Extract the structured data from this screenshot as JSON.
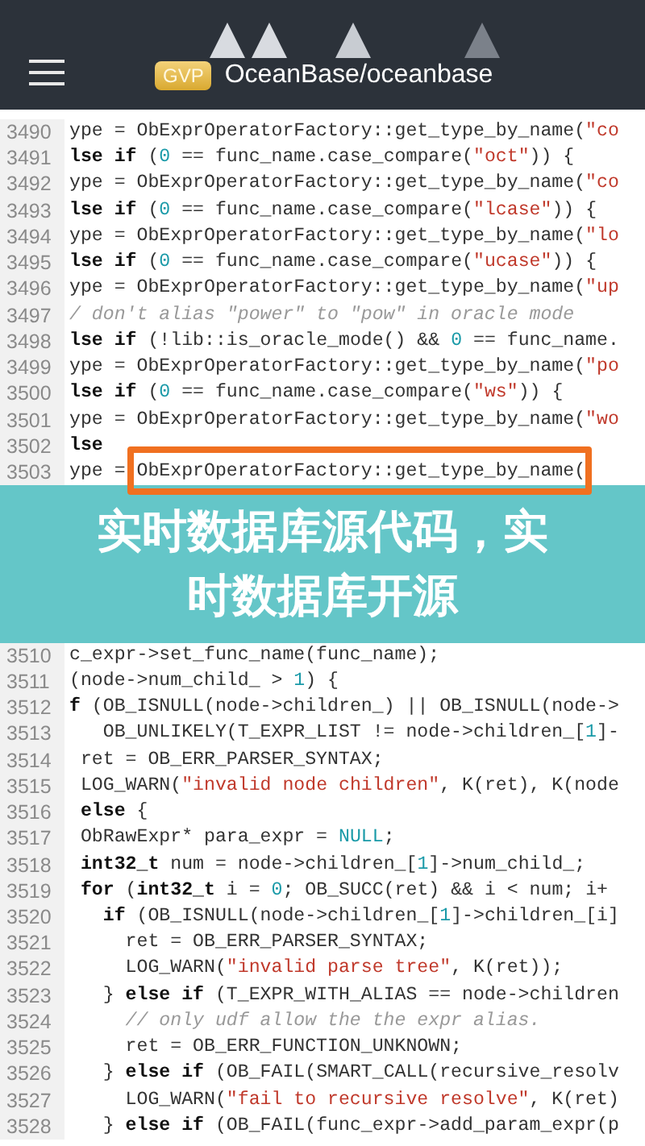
{
  "header": {
    "badge": "GVP",
    "repo": "OceanBase/oceanbase"
  },
  "code_top": [
    {
      "number": "3490",
      "tokens": [
        {
          "kind": "plain",
          "text": "ype = ObExprOperatorFactory::get_type_by_name("
        },
        {
          "kind": "string",
          "text": "\"co"
        }
      ]
    },
    {
      "number": "3491",
      "tokens": [
        {
          "kind": "keyword",
          "text": "lse if"
        },
        {
          "kind": "plain",
          "text": " ("
        },
        {
          "kind": "number",
          "text": "0"
        },
        {
          "kind": "plain",
          "text": " == func_name.case_compare("
        },
        {
          "kind": "string",
          "text": "\"oct\""
        },
        {
          "kind": "plain",
          "text": ")) {"
        }
      ]
    },
    {
      "number": "3492",
      "tokens": [
        {
          "kind": "plain",
          "text": "ype = ObExprOperatorFactory::get_type_by_name("
        },
        {
          "kind": "string",
          "text": "\"co"
        }
      ]
    },
    {
      "number": "3493",
      "tokens": [
        {
          "kind": "keyword",
          "text": "lse if"
        },
        {
          "kind": "plain",
          "text": " ("
        },
        {
          "kind": "number",
          "text": "0"
        },
        {
          "kind": "plain",
          "text": " == func_name.case_compare("
        },
        {
          "kind": "string",
          "text": "\"lcase\""
        },
        {
          "kind": "plain",
          "text": ")) {"
        }
      ]
    },
    {
      "number": "3494",
      "tokens": [
        {
          "kind": "plain",
          "text": "ype = ObExprOperatorFactory::get_type_by_name("
        },
        {
          "kind": "string",
          "text": "\"lo"
        }
      ]
    },
    {
      "number": "3495",
      "tokens": [
        {
          "kind": "keyword",
          "text": "lse if"
        },
        {
          "kind": "plain",
          "text": " ("
        },
        {
          "kind": "number",
          "text": "0"
        },
        {
          "kind": "plain",
          "text": " == func_name.case_compare("
        },
        {
          "kind": "string",
          "text": "\"ucase\""
        },
        {
          "kind": "plain",
          "text": ")) {"
        }
      ]
    },
    {
      "number": "3496",
      "tokens": [
        {
          "kind": "plain",
          "text": "ype = ObExprOperatorFactory::get_type_by_name("
        },
        {
          "kind": "string",
          "text": "\"up"
        }
      ]
    },
    {
      "number": "3497",
      "tokens": [
        {
          "kind": "comment",
          "text": "/ don't alias \"power\" to \"pow\" in oracle mode"
        }
      ]
    },
    {
      "number": "3498",
      "tokens": [
        {
          "kind": "keyword",
          "text": "lse if"
        },
        {
          "kind": "plain",
          "text": " (!lib::is_oracle_mode() && "
        },
        {
          "kind": "number",
          "text": "0"
        },
        {
          "kind": "plain",
          "text": " == func_name."
        }
      ]
    },
    {
      "number": "3499",
      "tokens": [
        {
          "kind": "plain",
          "text": "ype = ObExprOperatorFactory::get_type_by_name("
        },
        {
          "kind": "string",
          "text": "\"po"
        }
      ]
    },
    {
      "number": "3500",
      "tokens": [
        {
          "kind": "keyword",
          "text": "lse if"
        },
        {
          "kind": "plain",
          "text": " ("
        },
        {
          "kind": "number",
          "text": "0"
        },
        {
          "kind": "plain",
          "text": " == func_name.case_compare("
        },
        {
          "kind": "string",
          "text": "\"ws\""
        },
        {
          "kind": "plain",
          "text": ")) {"
        }
      ]
    },
    {
      "number": "3501",
      "tokens": [
        {
          "kind": "plain",
          "text": "ype = ObExprOperatorFactory::get_type_by_name("
        },
        {
          "kind": "string",
          "text": "\"wo"
        }
      ]
    },
    {
      "number": "3502",
      "tokens": [
        {
          "kind": "keyword",
          "text": "lse"
        }
      ]
    },
    {
      "number": "3503",
      "highlight": true,
      "tokens": [
        {
          "kind": "plain",
          "text": "ype = ObExprOperatorFactory::get_type_by_name("
        }
      ]
    }
  ],
  "banner": {
    "title": "实时数据库源代码，实时数据库开源"
  },
  "code_bottom": [
    {
      "number": "3510",
      "tokens": [
        {
          "kind": "plain",
          "text": "c_expr->set_func_name(func_name);"
        }
      ]
    },
    {
      "number": "3511",
      "tokens": [
        {
          "kind": "plain",
          "text": "(node->num_child_ > "
        },
        {
          "kind": "number",
          "text": "1"
        },
        {
          "kind": "plain",
          "text": ") {"
        }
      ]
    },
    {
      "number": "3512",
      "tokens": [
        {
          "kind": "keyword",
          "text": "f"
        },
        {
          "kind": "plain",
          "text": " (OB_ISNULL(node->children_) || OB_ISNULL(node->"
        }
      ]
    },
    {
      "number": "3513",
      "tokens": [
        {
          "kind": "plain",
          "text": "   OB_UNLIKELY(T_EXPR_LIST != node->children_["
        },
        {
          "kind": "number",
          "text": "1"
        },
        {
          "kind": "plain",
          "text": "]-"
        }
      ]
    },
    {
      "number": "3514",
      "tokens": [
        {
          "kind": "plain",
          "text": " ret = OB_ERR_PARSER_SYNTAX;"
        }
      ]
    },
    {
      "number": "3515",
      "tokens": [
        {
          "kind": "plain",
          "text": " LOG_WARN("
        },
        {
          "kind": "string",
          "text": "\"invalid node children\""
        },
        {
          "kind": "plain",
          "text": ", K(ret), K(node"
        }
      ]
    },
    {
      "number": "3516",
      "tokens": [
        {
          "kind": "keyword",
          "text": " else"
        },
        {
          "kind": "plain",
          "text": " {"
        }
      ]
    },
    {
      "number": "3517",
      "tokens": [
        {
          "kind": "plain",
          "text": " ObRawExpr* para_expr = "
        },
        {
          "kind": "number",
          "text": "NULL"
        },
        {
          "kind": "plain",
          "text": ";"
        }
      ]
    },
    {
      "number": "3518",
      "tokens": [
        {
          "kind": "keyword",
          "text": " int32_t"
        },
        {
          "kind": "plain",
          "text": " num = node->children_["
        },
        {
          "kind": "number",
          "text": "1"
        },
        {
          "kind": "plain",
          "text": "]->num_child_;"
        }
      ]
    },
    {
      "number": "3519",
      "tokens": [
        {
          "kind": "keyword",
          "text": " for"
        },
        {
          "kind": "plain",
          "text": " ("
        },
        {
          "kind": "keyword",
          "text": "int32_t"
        },
        {
          "kind": "plain",
          "text": " i = "
        },
        {
          "kind": "number",
          "text": "0"
        },
        {
          "kind": "plain",
          "text": "; OB_SUCC(ret) && i < num; i+"
        }
      ]
    },
    {
      "number": "3520",
      "tokens": [
        {
          "kind": "keyword",
          "text": "   if"
        },
        {
          "kind": "plain",
          "text": " (OB_ISNULL(node->children_["
        },
        {
          "kind": "number",
          "text": "1"
        },
        {
          "kind": "plain",
          "text": "]->children_[i]"
        }
      ]
    },
    {
      "number": "3521",
      "tokens": [
        {
          "kind": "plain",
          "text": "     ret = OB_ERR_PARSER_SYNTAX;"
        }
      ]
    },
    {
      "number": "3522",
      "tokens": [
        {
          "kind": "plain",
          "text": "     LOG_WARN("
        },
        {
          "kind": "string",
          "text": "\"invalid parse tree\""
        },
        {
          "kind": "plain",
          "text": ", K(ret));"
        }
      ]
    },
    {
      "number": "3523",
      "tokens": [
        {
          "kind": "plain",
          "text": "   } "
        },
        {
          "kind": "keyword",
          "text": "else if"
        },
        {
          "kind": "plain",
          "text": " (T_EXPR_WITH_ALIAS == node->children"
        }
      ]
    },
    {
      "number": "3524",
      "tokens": [
        {
          "kind": "comment",
          "text": "     // only udf allow the the expr alias."
        }
      ]
    },
    {
      "number": "3525",
      "tokens": [
        {
          "kind": "plain",
          "text": "     ret = OB_ERR_FUNCTION_UNKNOWN;"
        }
      ]
    },
    {
      "number": "3526",
      "tokens": [
        {
          "kind": "plain",
          "text": "   } "
        },
        {
          "kind": "keyword",
          "text": "else if"
        },
        {
          "kind": "plain",
          "text": " (OB_FAIL(SMART_CALL(recursive_resolv"
        }
      ]
    },
    {
      "number": "3527",
      "tokens": [
        {
          "kind": "plain",
          "text": "     LOG_WARN("
        },
        {
          "kind": "string",
          "text": "\"fail to recursive resolve\""
        },
        {
          "kind": "plain",
          "text": ", K(ret)"
        }
      ]
    },
    {
      "number": "3528",
      "tokens": [
        {
          "kind": "plain",
          "text": "   } "
        },
        {
          "kind": "keyword",
          "text": "else if"
        },
        {
          "kind": "plain",
          "text": " (OB_FAIL(func_expr->add_param_expr(p"
        }
      ]
    }
  ]
}
